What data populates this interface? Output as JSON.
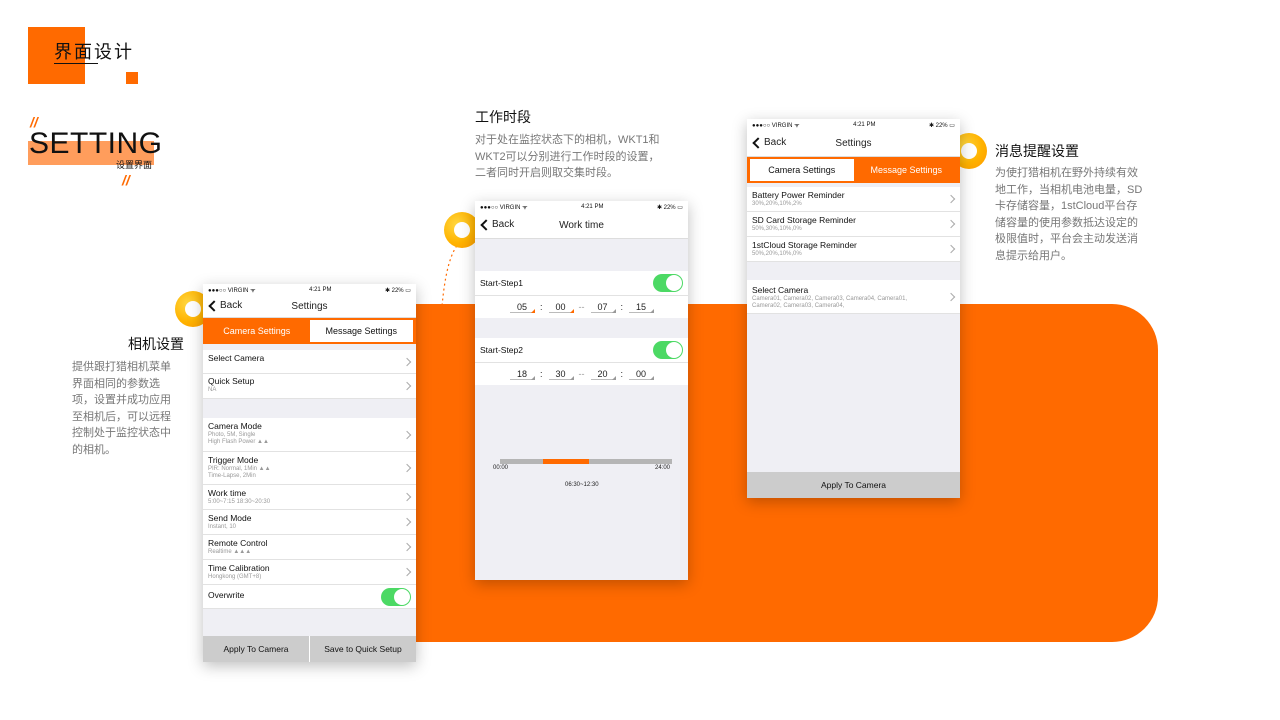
{
  "header": {
    "title": "界面设计"
  },
  "section": {
    "big": "SETTING",
    "small": "设置界面"
  },
  "annotations": [
    {
      "title": "相机设置",
      "desc": [
        "提供跟打猎相机菜单",
        "界面相同的参数选",
        "项，设置并成功应用",
        "至相机后，可以远程",
        "控制处于监控状态中",
        "的相机。"
      ]
    },
    {
      "title": "工作时段",
      "desc": [
        "对于处在监控状态下的相机，WKT1和",
        "WKT2可以分别进行工作时段的设置，",
        "二者同时开启则取交集时段。"
      ]
    },
    {
      "title": "消息提醒设置",
      "desc": [
        "为使打猎相机在野外持续有效",
        "地工作，当相机电池电量，SD",
        "卡存储容量，1stCloud平台存",
        "储容量的使用参数抵达设定的",
        "极限值时，平台会主动发送消",
        "息提示给用户。"
      ]
    }
  ],
  "status": {
    "carrier": "●●●○○ VIRGIN ᯤ",
    "time": "4:21 PM",
    "battery": "✱ 22% ▭"
  },
  "phone1": {
    "back": "Back",
    "title": "Settings",
    "tabs": [
      "Camera Settings",
      "Message Settings"
    ],
    "rows_top": [
      {
        "t": "Select Camera",
        "s": ""
      },
      {
        "t": "Quick Setup",
        "s": "NA"
      }
    ],
    "rows": [
      {
        "t": "Camera Mode",
        "s": "Photo, 5M, Single\nHigh Flash Power ▲▲"
      },
      {
        "t": "Trigger Mode",
        "s": "PIR: Normal, 1Min ▲▲\nTime-Lapse, 2Min"
      },
      {
        "t": "Work time",
        "s": "5:00~7:15    18:30~20:30"
      },
      {
        "t": "Send Mode",
        "s": "Instant, 10"
      },
      {
        "t": "Remote Control",
        "s": "Realtime ▲▲▲"
      },
      {
        "t": "Time Calibration",
        "s": "Hongkong (GMT+8)"
      }
    ],
    "overwrite": "Overwrite",
    "bottom": [
      "Apply To Camera",
      "Save to Quick Setup"
    ]
  },
  "phone2": {
    "back": "Back",
    "title": "Work time",
    "step1": "Start-Step1",
    "times1": [
      "05",
      "00",
      "07",
      "15"
    ],
    "step2": "Start-Step2",
    "times2": [
      "18",
      "30",
      "20",
      "00"
    ],
    "colon": ":",
    "dash": "--",
    "range_start": "00:00",
    "range_end": "24:00",
    "range_label": "06:30~12:30",
    "range_fill": {
      "start": 0.25,
      "end": 0.52
    }
  },
  "phone3": {
    "back": "Back",
    "title": "Settings",
    "tabs": [
      "Camera Settings",
      "Message Settings"
    ],
    "rows": [
      {
        "t": "Battery Power Reminder",
        "s": "30%,20%,10%,2%"
      },
      {
        "t": "SD Card Storage Reminder",
        "s": "50%,30%,10%,0%"
      },
      {
        "t": "1stCloud Storage Reminder",
        "s": "50%,20%,10%,0%"
      }
    ],
    "camera": {
      "t": "Select Camera",
      "s": "Camera01, Camera02, Camera03, Camera04, Camera01,\nCamera02, Camera03, Camera04,"
    },
    "bottom": "Apply To Camera"
  }
}
